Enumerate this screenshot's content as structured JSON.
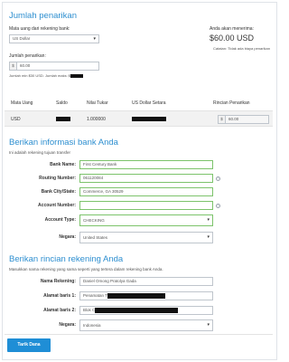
{
  "summary": {
    "title": "Jumlah penarikan",
    "currency_label": "Mata uang dari rekening bank:",
    "currency_value": "US Dollar",
    "amount_label": "Jumlah penarikan:",
    "amount_prefix": "$",
    "amount_value": "60.00",
    "min_note": "Jumlah min $30 USD. Jumlah maks: $",
    "receive_label": "Anda akan menerima:",
    "receive_value": "$60.00 USD",
    "receive_note": "Catatan: Tidak ada biaya penarikan"
  },
  "table": {
    "headers": [
      "Mata Uang",
      "Saldo",
      "Nilai Tukar",
      "US Dollar Setara",
      "Rincian Penarikan"
    ],
    "row": {
      "currency": "USD",
      "rate": "1.000000",
      "amount_prefix": "$",
      "amount_value": "60.00"
    }
  },
  "bank": {
    "title": "Berikan informasi bank Anda",
    "subtitle": "Ini adalah rekening tujuan transfer",
    "fields": [
      {
        "label": "Bank Name:",
        "value": "First Century Bank"
      },
      {
        "label": "Routing Number:",
        "value": "061120084"
      },
      {
        "label": "Bank City/State:",
        "value": "Commerce, GA 30529"
      },
      {
        "label": "Account Number:",
        "value": ""
      },
      {
        "label": "Account Type:",
        "value": "CHECKING"
      },
      {
        "label": "Negara:",
        "value": "United States"
      }
    ]
  },
  "account": {
    "title": "Berikan rincian rekening Anda",
    "subtitle": "Masukkan nama rekening yang sama seperti yang tertera dalam rekening bank Anda.",
    "fields": [
      {
        "label": "Nama Rekening:",
        "value": "Daniel Omong Pratolya Gada"
      },
      {
        "label": "Alamat baris 1:",
        "value": "Penamatan T"
      },
      {
        "label": "Alamat baris 2:",
        "value": "Blok C"
      },
      {
        "label": "Negara:",
        "value": "Indonesia"
      }
    ]
  },
  "submit_label": "Tarik Dana",
  "colors": {
    "accent": "#2e8fd0",
    "button": "#1f8ed6",
    "valid_border": "#7cc36b"
  }
}
